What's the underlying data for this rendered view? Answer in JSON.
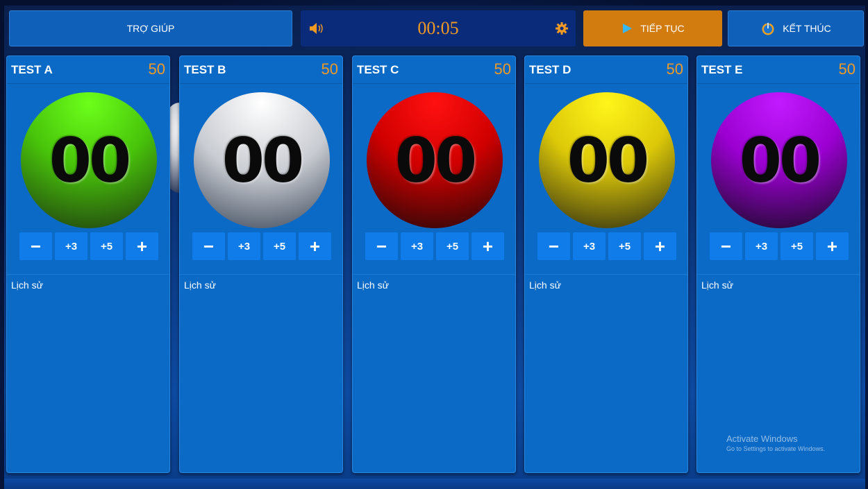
{
  "toolbar": {
    "help_label": "TRỢ GIÚP",
    "timer": "00:05",
    "continue_label": "TIẾP TỤC",
    "end_label": "KẾT THÚC",
    "timer_color": "#f09a23",
    "continue_color": "#d27c10"
  },
  "teams": [
    {
      "name": "TEST A",
      "total": "50",
      "score": "00",
      "ball_color": "#53d90a",
      "history_label": "Lịch sử",
      "controls": {
        "minus": "−",
        "plus3": "+3",
        "plus5": "+5",
        "plus": "+"
      }
    },
    {
      "name": "TEST B",
      "total": "50",
      "score": "00",
      "ball_color": "#e6e8ec",
      "history_label": "Lịch sử",
      "controls": {
        "minus": "−",
        "plus3": "+3",
        "plus5": "+5",
        "plus": "+"
      }
    },
    {
      "name": "TEST C",
      "total": "50",
      "score": "00",
      "ball_color": "#e00000",
      "history_label": "Lịch sử",
      "controls": {
        "minus": "−",
        "plus3": "+3",
        "plus5": "+5",
        "plus": "+"
      }
    },
    {
      "name": "TEST D",
      "total": "50",
      "score": "00",
      "ball_color": "#f0e000",
      "history_label": "Lịch sử",
      "controls": {
        "minus": "−",
        "plus3": "+3",
        "plus5": "+5",
        "plus": "+"
      }
    },
    {
      "name": "TEST E",
      "total": "50",
      "score": "00",
      "ball_color": "#b000e8",
      "history_label": "Lịch sử",
      "controls": {
        "minus": "−",
        "plus3": "+3",
        "plus5": "+5",
        "plus": "+"
      }
    }
  ],
  "watermark": {
    "line1": "Activate Windows",
    "line2": "Go to Settings to activate Windows."
  }
}
